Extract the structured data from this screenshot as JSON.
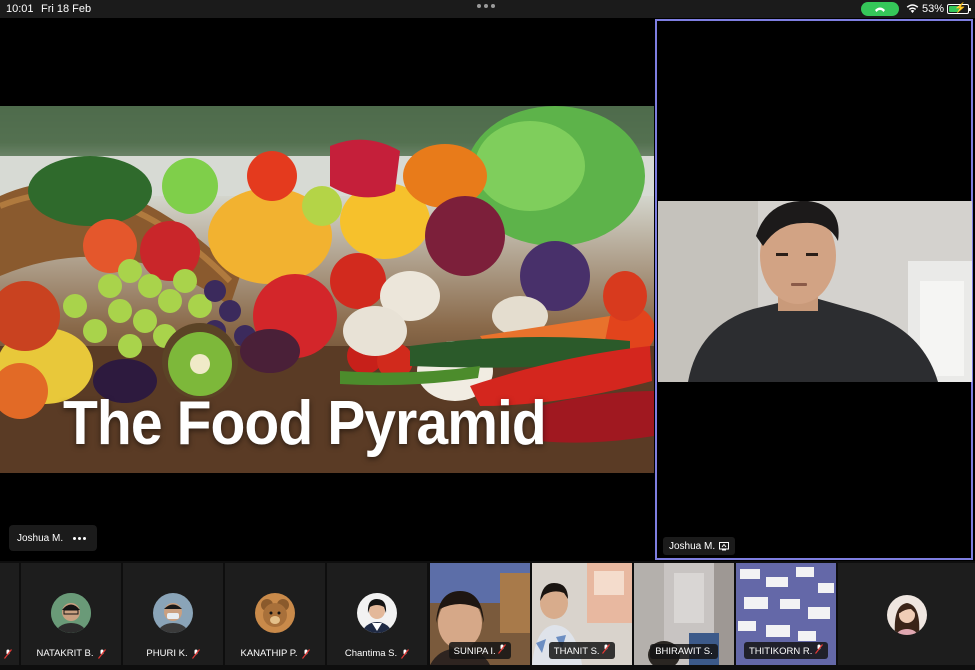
{
  "status_bar": {
    "time": "10:01",
    "date": "Fri 18 Feb",
    "battery_percent": "53%",
    "battery_level": 0.53,
    "call_indicator_color": "#35c759"
  },
  "share": {
    "slide_title": "The Food Pyramid",
    "presenter_name": "Joshua M."
  },
  "speaker": {
    "name": "Joshua M.",
    "border_color": "#7e7ee0"
  },
  "gallery": [
    {
      "name": "NATAKRIT B.",
      "kind": "avatar",
      "muted": true
    },
    {
      "name": "PHURI K.",
      "kind": "avatar",
      "muted": true
    },
    {
      "name": "KANATHIP P.",
      "kind": "avatar",
      "muted": true
    },
    {
      "name": "Chantima S.",
      "kind": "avatar",
      "muted": true
    },
    {
      "name": "SUNIPA I.",
      "kind": "video",
      "muted": true
    },
    {
      "name": "THANIT S.",
      "kind": "video",
      "muted": true
    },
    {
      "name": "BHIRAWIT S.",
      "kind": "video",
      "muted": false
    },
    {
      "name": "THITIKORN R.",
      "kind": "video",
      "muted": true
    }
  ]
}
